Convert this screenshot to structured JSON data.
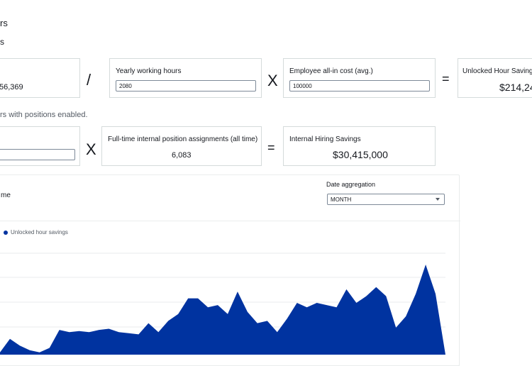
{
  "header": {
    "title_fragment": "rs",
    "subtitle_fragment": "s"
  },
  "row1": {
    "card_left_value": "56,369",
    "op_divide": "/",
    "yearly_hours_label": "Yearly working hours",
    "yearly_hours_value": "2080",
    "op_multiply": "X",
    "cost_label": "Employee all-in cost (avg.)",
    "cost_value": "100000",
    "op_equals": "=",
    "unlocked_label": "Unlocked Hour Savings",
    "unlocked_value": "$214,24"
  },
  "note": "rs with positions enabled.",
  "row2": {
    "left_input_value": "",
    "op_multiply": "X",
    "assignments_label": "Full-time internal position assignments (all time)",
    "assignments_value": "6,083",
    "op_equals": "=",
    "hiring_label": "Internal Hiring Savings",
    "hiring_value": "$30,415,000"
  },
  "chart_panel": {
    "title_fragment": "me",
    "date_agg_label": "Date aggregation",
    "date_agg_value": "MONTH",
    "legend_label": "Unlocked hour savings"
  },
  "colors": {
    "series": "#0033a0",
    "grid": "#e9ebed",
    "border": "#d5dbdb"
  },
  "chart_data": {
    "type": "area",
    "series": [
      {
        "name": "Unlocked hour savings",
        "values": [
          1,
          7,
          4,
          2,
          1,
          3,
          11,
          10,
          10.5,
          10,
          11,
          11.5,
          10,
          9.5,
          9,
          14,
          10,
          15,
          18,
          25,
          25,
          21,
          22,
          18,
          28,
          19,
          14,
          15,
          10,
          16,
          23,
          21,
          23,
          22,
          21,
          29,
          23,
          26,
          30,
          26,
          12,
          17,
          27,
          40,
          27,
          0
        ]
      }
    ],
    "grid": true,
    "legend": "top-left"
  }
}
